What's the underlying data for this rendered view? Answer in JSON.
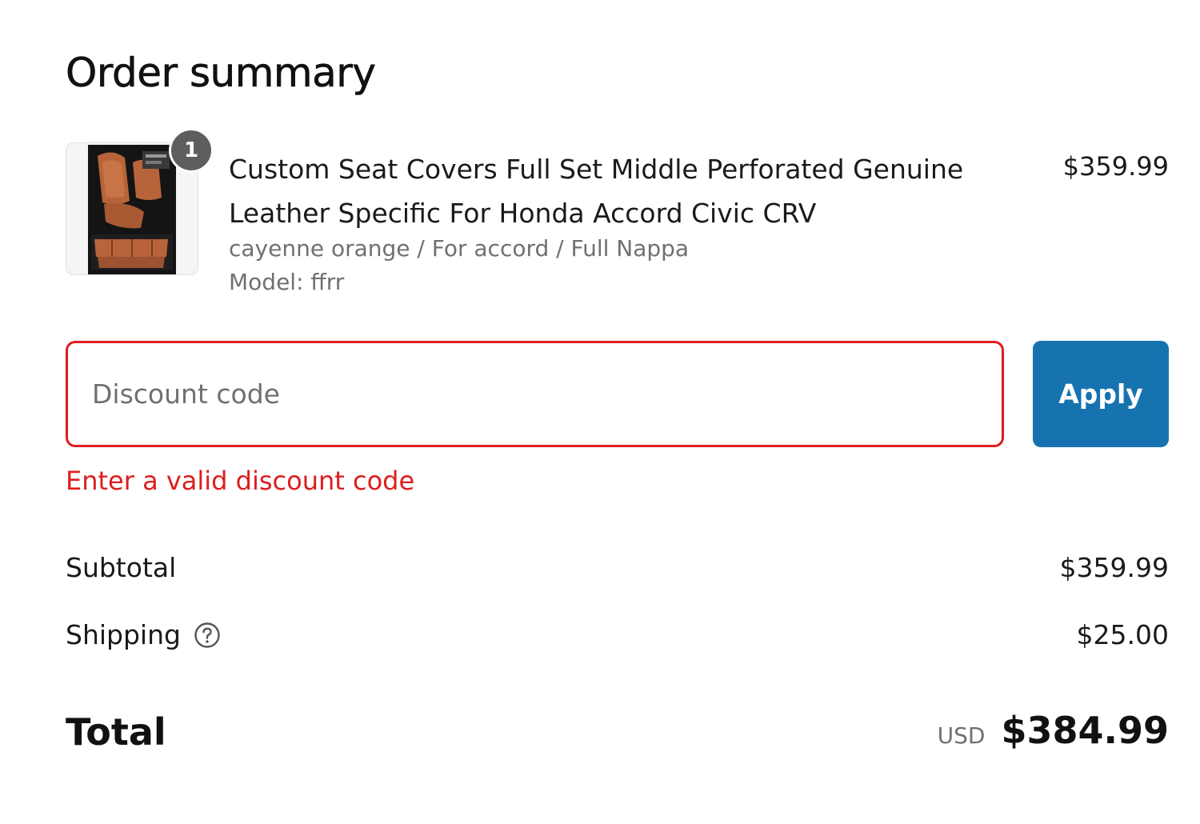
{
  "title": "Order summary",
  "product": {
    "quantity": "1",
    "name": "Custom Seat Covers Full Set Middle Perforated Genuine Leather Specific For Honda Accord Civic CRV",
    "variant": "cayenne orange / For accord / Full Nappa",
    "model": "Model: ffrr",
    "price": "$359.99",
    "image_icon": "car-seat-cover-image"
  },
  "discount": {
    "placeholder": "Discount code",
    "value": "",
    "apply_label": "Apply",
    "error": "Enter a valid discount code"
  },
  "totals": {
    "subtotal_label": "Subtotal",
    "subtotal_value": "$359.99",
    "shipping_label": "Shipping",
    "shipping_value": "$25.00",
    "total_label": "Total",
    "currency": "USD",
    "total_value": "$384.99"
  },
  "colors": {
    "accent": "#1773b0",
    "error": "#dd1d1d",
    "badge": "#5e5e5e",
    "muted_text": "#707070"
  }
}
